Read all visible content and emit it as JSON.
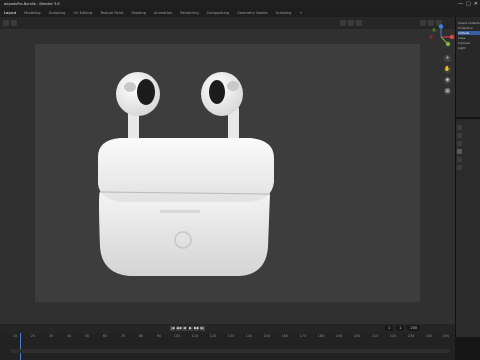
{
  "titlebar": {
    "title": "airpodsPro-Bundle - Blender 3.6",
    "controls": [
      "—",
      "▢",
      "✕"
    ]
  },
  "menubar": {
    "items": [
      "Layout",
      "Modeling",
      "Sculpting",
      "UV Editing",
      "Texture Paint",
      "Shading",
      "Animation",
      "Rendering",
      "Compositing",
      "Geometry Nodes",
      "Scripting",
      "+"
    ],
    "active_index": 0
  },
  "outliner": {
    "rows": [
      "Scene Collection",
      "Collection",
      "AirPods",
      "Case",
      "Camera",
      "Light"
    ],
    "selected_index": 2
  },
  "timeline": {
    "frames": [
      "10",
      "20",
      "30",
      "40",
      "50",
      "60",
      "70",
      "80",
      "90",
      "100",
      "110",
      "120",
      "130",
      "140",
      "150",
      "160",
      "170",
      "180",
      "190",
      "200",
      "210",
      "220",
      "230",
      "240",
      "250"
    ],
    "current_frame": "1",
    "start": "1",
    "end": "250",
    "play_controls": [
      "|◀",
      "◀◀",
      "◀",
      "▶",
      "▶▶",
      "▶|"
    ]
  },
  "gizmo": {
    "colors": {
      "x": "#e0434a",
      "y": "#7fb23b",
      "z": "#3f7fe0"
    }
  },
  "colors": {
    "viewport_bg": "#303030",
    "camera_frame": "#3d3d3d",
    "accent": "#3a5fa0"
  }
}
